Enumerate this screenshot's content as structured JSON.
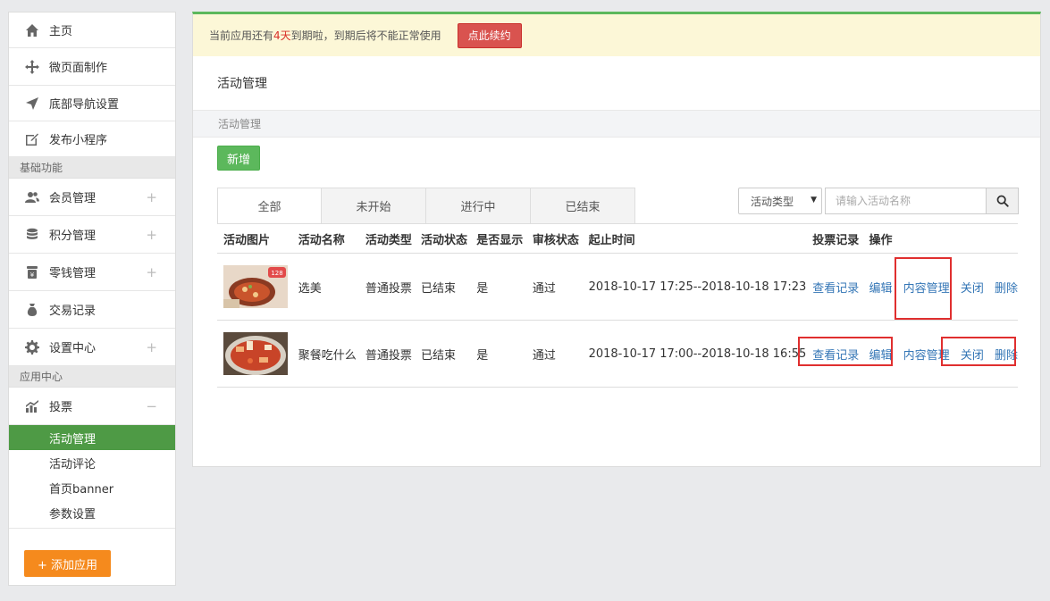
{
  "sidebar": {
    "top_items": [
      {
        "label": "主页",
        "icon": "home-icon"
      },
      {
        "label": "微页面制作",
        "icon": "move-icon"
      },
      {
        "label": "底部导航设置",
        "icon": "send-icon"
      },
      {
        "label": "发布小程序",
        "icon": "edit-icon"
      }
    ],
    "section1": "基础功能",
    "basic_items": [
      {
        "label": "会员管理",
        "icon": "users-icon",
        "toggle": "+"
      },
      {
        "label": "积分管理",
        "icon": "database-icon",
        "toggle": "+"
      },
      {
        "label": "零钱管理",
        "icon": "wallet-icon",
        "toggle": "+"
      },
      {
        "label": "交易记录",
        "icon": "money-bag-icon"
      },
      {
        "label": "设置中心",
        "icon": "gear-icon",
        "toggle": "+"
      }
    ],
    "section2": "应用中心",
    "vote": {
      "label": "投票",
      "icon": "bar-chart-icon",
      "toggle": "−"
    },
    "vote_sub": [
      "活动管理",
      "活动评论",
      "首页banner",
      "参数设置"
    ],
    "add_app": "+ 添加应用"
  },
  "notice": {
    "prefix": "当前应用还有",
    "days": "4天",
    "suffix": "到期啦，到期后将不能正常使用",
    "button": "点此续约"
  },
  "page_title": "活动管理",
  "breadcrumb": "活动管理",
  "new_button": "新增",
  "tabs": [
    "全部",
    "未开始",
    "进行中",
    "已结束"
  ],
  "filter": {
    "type_select": "活动类型",
    "search_placeholder": "请输入活动名称"
  },
  "table": {
    "headers": [
      "活动图片",
      "活动名称",
      "活动类型",
      "活动状态",
      "是否显示",
      "审核状态",
      "起止时间",
      "投票记录",
      "操作"
    ],
    "rows": [
      {
        "name": "选美",
        "type": "普通投票",
        "status": "已结束",
        "visible": "是",
        "review": "通过",
        "time": "2018-10-17 17:25--2018-10-18 17:23",
        "actions": {
          "records": "查看记录",
          "edit": "编辑",
          "content": "内容管理",
          "close": "关闭",
          "delete": "删除"
        }
      },
      {
        "name": "聚餐吃什么",
        "type": "普通投票",
        "status": "已结束",
        "visible": "是",
        "review": "通过",
        "time": "2018-10-17 17:00--2018-10-18 16:55",
        "actions": {
          "records": "查看记录",
          "edit": "编辑",
          "content": "内容管理",
          "close": "关闭",
          "delete": "删除"
        }
      }
    ]
  },
  "colors": {
    "accent_green": "#5cb85c",
    "active_green": "#4e9a45",
    "danger": "#d9534f",
    "orange": "#f58a1d",
    "link": "#3476b6",
    "highlight": "#e02f2f"
  }
}
